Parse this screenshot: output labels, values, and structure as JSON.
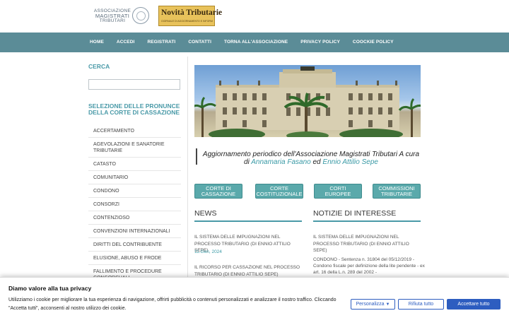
{
  "header": {
    "logo1_line1": "ASSOCIAZIONE",
    "logo1_line2": "MAGISTRATI",
    "logo1_line3": "TRIBUTARI",
    "logo2_title": "Novità Tributarie",
    "logo2_sub": "GIORNALE DI AGGIORNAMENTO E INFORMAZIONE"
  },
  "nav": {
    "items": [
      "HOME",
      "ACCEDI",
      "REGISTRATI",
      "CONTATTI",
      "TORNA ALL'ASSOCIAZIONE",
      "PRIVACY POLICY",
      "COOCKIE POLICY"
    ]
  },
  "sidebar": {
    "search_title": "CERCA",
    "search_placeholder": "",
    "categories_title_line1": "SELEZIONE DELLE PRONUNCE",
    "categories_title_line2": "DELLA CORTE DI CASSAZIONE",
    "categories": [
      "ACCERTAMENTO",
      "AGEVOLAZIONI E SANATORIE TRIBUTARIE",
      "CATASTO",
      "COMUNITARIO",
      "CONDONO",
      "CONSORZI",
      "CONTENZIOSO",
      "CONVENZIONI INTERNAZIONALI",
      "DIRITTI DEL CONTRIBUENTE",
      "ELUSIONE, ABUSO E FRODE",
      "FALLIMENTO E PROCEDURE CONCORSUALI"
    ]
  },
  "main": {
    "tagline_prefix": "Aggiornamento periodico dell'Associazione Magistrati Tributari A cura di ",
    "tagline_author1": "Annamaria Fasano",
    "tagline_joiner": " ed ",
    "tagline_author2": "Ennio Attilio Sepe",
    "buttons": [
      {
        "line1": "CORTE DI",
        "line2": "CASSAZIONE"
      },
      {
        "line1": "CORTE",
        "line2": "COSTITUZIONALE"
      },
      {
        "line1": "CORTI",
        "line2": "EUROPEE"
      },
      {
        "line1": "COMMISSIONI",
        "line2": "TRIBUTARIE"
      }
    ],
    "news_title": "NEWS",
    "news": [
      {
        "title": "IL SISTEMA DELLE IMPUGNAZIONI NEL PROCESSO TRIBUTARIO (di Ennio Attilio SEPE)",
        "date": "11.Gen, 2024"
      },
      {
        "title": "IL RICORSO PER CASSAZIONE NEL PROCESSO TRIBUTARIO (di Ennio Attilio SEPE)",
        "date": ""
      }
    ],
    "interest_title": "NOTIZIE DI INTERESSE",
    "interest": [
      "IL SISTEMA DELLE IMPUGNAZIONI NEL PROCESSO TRIBUTARIO (di Ennio Attilio SEPE)",
      "CONDONO - Sentenza n. 31804 del 05/12/2019 - Condono fiscale per definizione della lite pendente - ex art. 16 della L.n. 289 del 2002 -"
    ]
  },
  "cookie": {
    "title": "Diamo valore alla tua privacy",
    "text": "Utilizziamo i cookie per migliorare la tua esperienza di navigazione, offrirti pubblicità o contenuti personalizzati e analizzare il nostro traffico. Cliccando \"Accetta tutti\", acconsenti al nostro utilizzo dei cookie.",
    "customize_label": "Personalizza",
    "reject_label": "Rifiuta tutto",
    "accept_label": "Accettare tutto",
    "accent": "#2d5dc0"
  }
}
